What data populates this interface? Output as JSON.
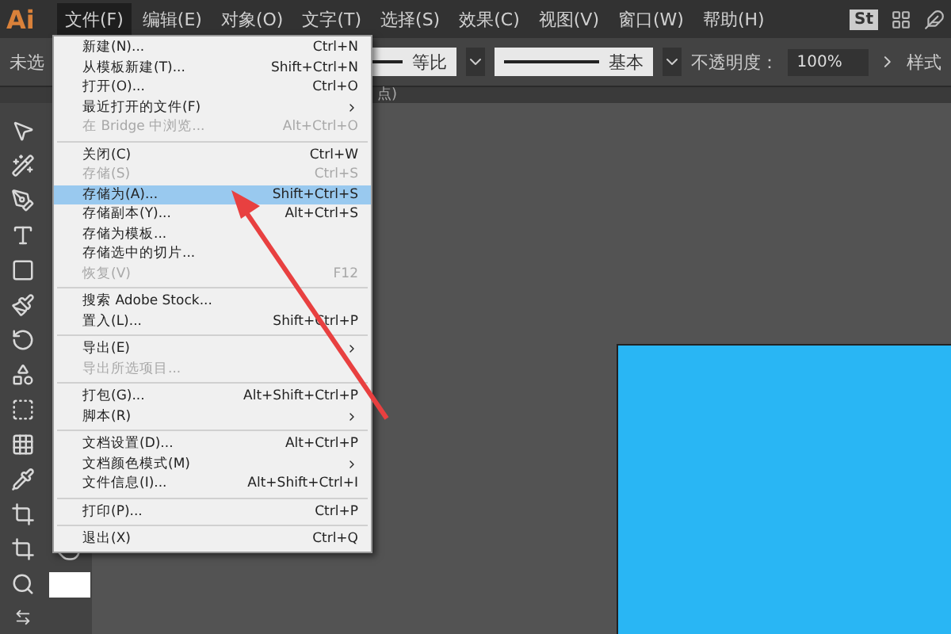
{
  "app_logo": "Ai",
  "menu_bar": [
    {
      "label": "文件(F)",
      "selected": true
    },
    {
      "label": "编辑(E)",
      "selected": false
    },
    {
      "label": "对象(O)",
      "selected": false
    },
    {
      "label": "文字(T)",
      "selected": false
    },
    {
      "label": "选择(S)",
      "selected": false
    },
    {
      "label": "效果(C)",
      "selected": false
    },
    {
      "label": "视图(V)",
      "selected": false
    },
    {
      "label": "窗口(W)",
      "selected": false
    },
    {
      "label": "帮助(H)",
      "selected": false
    }
  ],
  "header_badge": "St",
  "control_bar": {
    "selection_label": "未选",
    "stroke_profile": "等比",
    "brush": "基本",
    "opacity_label": "不透明度：",
    "opacity_value": "100%",
    "style_label": "样式"
  },
  "document_tab": "点)",
  "file_menu": [
    {
      "kind": "item",
      "label": "新建(N)...",
      "shortcut": "Ctrl+N",
      "disabled": false,
      "submenu": false,
      "selected": false
    },
    {
      "kind": "item",
      "label": "从模板新建(T)...",
      "shortcut": "Shift+Ctrl+N",
      "disabled": false,
      "submenu": false,
      "selected": false
    },
    {
      "kind": "item",
      "label": "打开(O)...",
      "shortcut": "Ctrl+O",
      "disabled": false,
      "submenu": false,
      "selected": false
    },
    {
      "kind": "item",
      "label": "最近打开的文件(F)",
      "disabled": false,
      "submenu": true,
      "selected": false
    },
    {
      "kind": "item",
      "label": "在 Bridge 中浏览...",
      "shortcut": "Alt+Ctrl+O",
      "disabled": true,
      "submenu": false,
      "selected": false
    },
    {
      "kind": "separator"
    },
    {
      "kind": "item",
      "label": "关闭(C)",
      "shortcut": "Ctrl+W",
      "disabled": false,
      "submenu": false,
      "selected": false
    },
    {
      "kind": "item",
      "label": "存储(S)",
      "shortcut": "Ctrl+S",
      "disabled": true,
      "submenu": false,
      "selected": false
    },
    {
      "kind": "item",
      "label": "存储为(A)...",
      "shortcut": "Shift+Ctrl+S",
      "disabled": false,
      "submenu": false,
      "selected": true
    },
    {
      "kind": "item",
      "label": "存储副本(Y)...",
      "shortcut": "Alt+Ctrl+S",
      "disabled": false,
      "submenu": false,
      "selected": false
    },
    {
      "kind": "item",
      "label": "存储为模板...",
      "disabled": false,
      "submenu": false,
      "selected": false
    },
    {
      "kind": "item",
      "label": "存储选中的切片...",
      "disabled": false,
      "submenu": false,
      "selected": false
    },
    {
      "kind": "item",
      "label": "恢复(V)",
      "shortcut": "F12",
      "disabled": true,
      "submenu": false,
      "selected": false
    },
    {
      "kind": "separator"
    },
    {
      "kind": "item",
      "label": "搜索 Adobe Stock...",
      "disabled": false,
      "submenu": false,
      "selected": false
    },
    {
      "kind": "item",
      "label": "置入(L)...",
      "shortcut": "Shift+Ctrl+P",
      "disabled": false,
      "submenu": false,
      "selected": false
    },
    {
      "kind": "separator"
    },
    {
      "kind": "item",
      "label": "导出(E)",
      "disabled": false,
      "submenu": true,
      "selected": false
    },
    {
      "kind": "item",
      "label": "导出所选项目...",
      "disabled": true,
      "submenu": false,
      "selected": false
    },
    {
      "kind": "separator"
    },
    {
      "kind": "item",
      "label": "打包(G)...",
      "shortcut": "Alt+Shift+Ctrl+P",
      "disabled": false,
      "submenu": false,
      "selected": false
    },
    {
      "kind": "item",
      "label": "脚本(R)",
      "disabled": false,
      "submenu": true,
      "selected": false
    },
    {
      "kind": "separator"
    },
    {
      "kind": "item",
      "label": "文档设置(D)...",
      "shortcut": "Alt+Ctrl+P",
      "disabled": false,
      "submenu": false,
      "selected": false
    },
    {
      "kind": "item",
      "label": "文档颜色模式(M)",
      "disabled": false,
      "submenu": true,
      "selected": false
    },
    {
      "kind": "item",
      "label": "文件信息(I)...",
      "shortcut": "Alt+Shift+Ctrl+I",
      "disabled": false,
      "submenu": false,
      "selected": false
    },
    {
      "kind": "separator"
    },
    {
      "kind": "item",
      "label": "打印(P)...",
      "shortcut": "Ctrl+P",
      "disabled": false,
      "submenu": false,
      "selected": false
    },
    {
      "kind": "separator"
    },
    {
      "kind": "item",
      "label": "退出(X)",
      "shortcut": "Ctrl+Q",
      "disabled": false,
      "submenu": false,
      "selected": false
    }
  ]
}
